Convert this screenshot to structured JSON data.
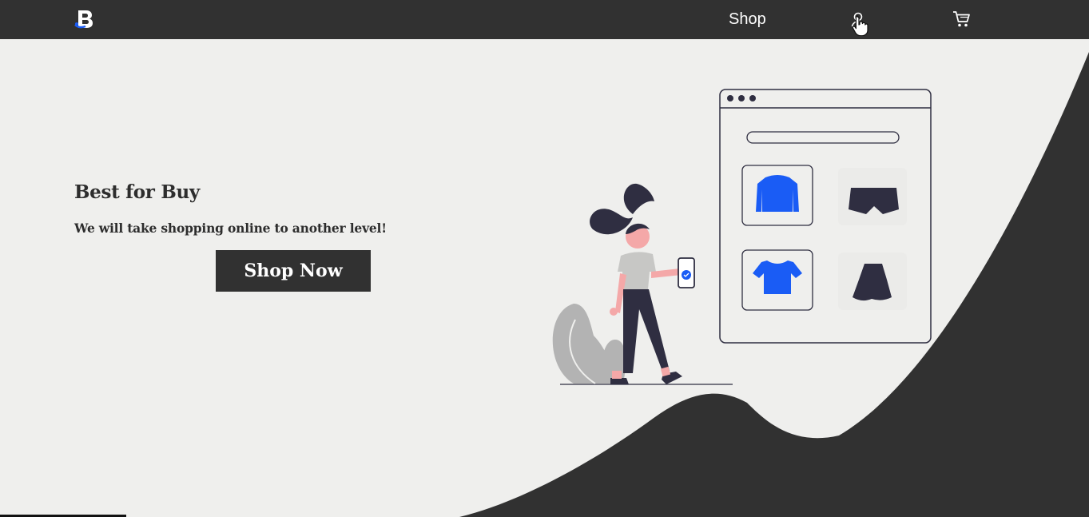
{
  "nav": {
    "logo_icon": "brand-b-logo",
    "shop_label": "Shop",
    "user_icon": "user-icon",
    "cart_icon": "cart-icon"
  },
  "hero": {
    "title": "Best for Buy",
    "subtitle": "We will take shopping online to another level!",
    "cta_label": "Shop Now"
  },
  "illustration": {
    "name": "online-shopping-illustration",
    "items": [
      "sweater-icon",
      "shorts-icon",
      "crop-top-icon",
      "skirt-icon"
    ]
  },
  "colors": {
    "dark": "#313131",
    "background": "#efefed",
    "accent": "#1a5cf5",
    "figure_skin": "#f4a8a8"
  }
}
